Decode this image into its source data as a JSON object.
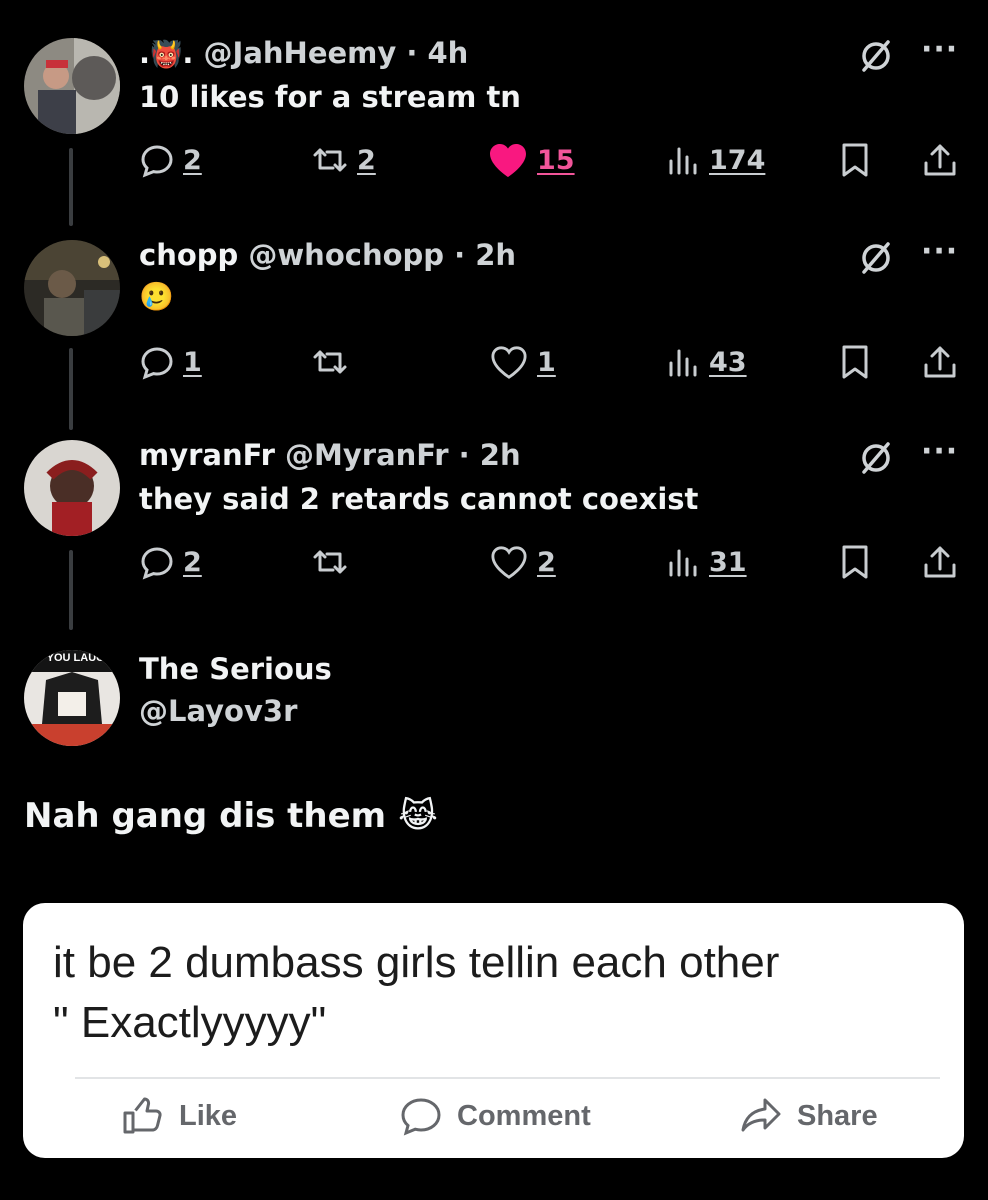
{
  "tweets": [
    {
      "display_name_prefix": ".",
      "display_name_emoji": "👹",
      "display_name_suffix": ".",
      "handle": "@JahHeemy",
      "time": "· 4h",
      "text": "10 likes for a stream tn",
      "replies": "2",
      "reposts": "2",
      "likes": "15",
      "liked": true,
      "views": "174"
    },
    {
      "display_name": "chopp",
      "handle": "@whochopp",
      "time": "· 2h",
      "text": "🥲",
      "replies": "1",
      "reposts": "",
      "likes": "1",
      "liked": false,
      "views": "43"
    },
    {
      "display_name": "myranFr",
      "handle": "@MyranFr",
      "time": "· 2h",
      "text": "they said 2 retards cannot coexist",
      "replies": "2",
      "reposts": "",
      "likes": "2",
      "liked": false,
      "views": "31"
    }
  ],
  "icons": {
    "reply": "reply-icon",
    "repost": "repost-icon",
    "like": "heart-icon",
    "views": "views-icon",
    "bookmark": "bookmark-icon",
    "share": "share-icon",
    "grok": "grok-icon",
    "more": "more-icon"
  },
  "more_label": "···",
  "quoted": {
    "avatar_text": "IF YOU LAUG.",
    "display_name": "The Serious",
    "handle": "@Layov3r",
    "text": "Nah gang dis them",
    "emoji": "😹",
    "card": {
      "text_line1": "it be 2 dumbass girls tellin each other",
      "text_line2": "\" Exactlyyyyy\"",
      "like_label": "Like",
      "comment_label": "Comment",
      "share_label": "Share"
    }
  },
  "colors": {
    "background": "#000000",
    "text": "#f2f4f5",
    "secondary": "#c9cdd0",
    "like_pink": "#f91880",
    "card_bg": "#ffffff"
  }
}
